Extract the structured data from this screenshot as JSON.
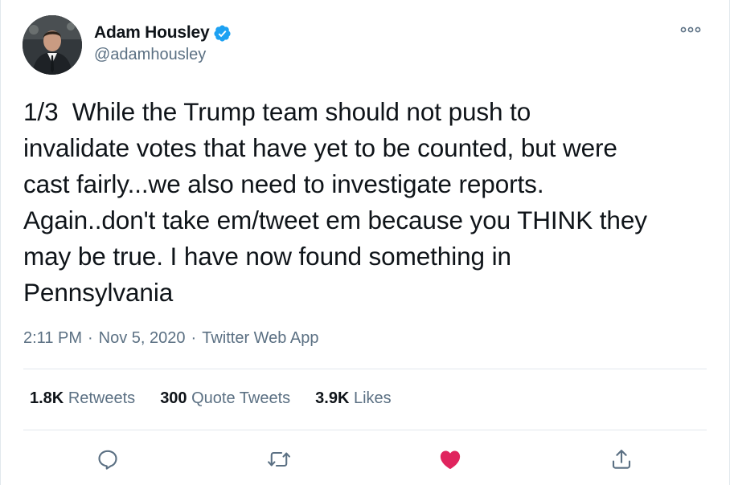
{
  "author": {
    "display_name": "Adam Housley",
    "handle": "@adamhousley",
    "verified": true
  },
  "tweet": {
    "text": "1/3  While the Trump team should not push to\ninvalidate votes that have yet to be counted, but were\ncast fairly...we also need to investigate reports.\nAgain..don't take em/tweet em because you THINK they\nmay be true. I have now found something in\nPennsylvania",
    "time": "2:11 PM",
    "date": "Nov 5, 2020",
    "separator": "·",
    "source": "Twitter Web App"
  },
  "stats": {
    "retweets_count": "1.8K",
    "retweets_label": "Retweets",
    "quote_count": "300",
    "quote_label": "Quote Tweets",
    "likes_count": "3.9K",
    "likes_label": "Likes"
  },
  "icons": {
    "more": "more-icon",
    "reply": "reply-icon",
    "retweet": "retweet-icon",
    "like": "heart-icon",
    "share": "share-icon",
    "verified": "verified-badge-icon"
  },
  "colors": {
    "accent": "#1da1f2",
    "like": "#e0245e",
    "muted": "#5b7083",
    "text": "#0f1419",
    "divider": "#e1e8ed"
  }
}
